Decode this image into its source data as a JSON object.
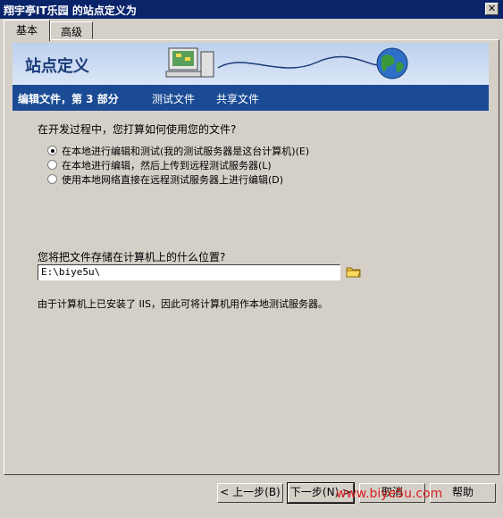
{
  "window": {
    "title": "翔宇亭IT乐园 的站点定义为",
    "close_glyph": "✕"
  },
  "tabs": [
    {
      "label": "基本"
    },
    {
      "label": "高级"
    }
  ],
  "banner": {
    "title": "站点定义"
  },
  "steps": {
    "current": "编辑文件，第 3 部分",
    "test": "测试文件",
    "share": "共享文件"
  },
  "question1": "在开发过程中，您打算如何使用您的文件?",
  "options": [
    {
      "label": "在本地进行编辑和测试(我的测试服务器是这台计算机)(E)",
      "checked": true
    },
    {
      "label": "在本地进行编辑，然后上传到远程测试服务器(L)",
      "checked": false
    },
    {
      "label": "使用本地网络直接在远程测试服务器上进行编辑(D)",
      "checked": false
    }
  ],
  "question2": "您将把文件存储在计算机上的什么位置?",
  "path_value": "E:\\biye5u\\",
  "note": "由于计算机上已安装了 IIS，因此可将计算机用作本地测试服务器。",
  "buttons": {
    "back": "< 上一步(B)",
    "next": "下一步(N) >",
    "cancel": "取消",
    "help": "帮助"
  },
  "watermark": "www.biye5u.com",
  "colors": {
    "titlebar": "#0a246a",
    "steps_bar": "#1a4b94",
    "banner": "#c8d8f0"
  }
}
